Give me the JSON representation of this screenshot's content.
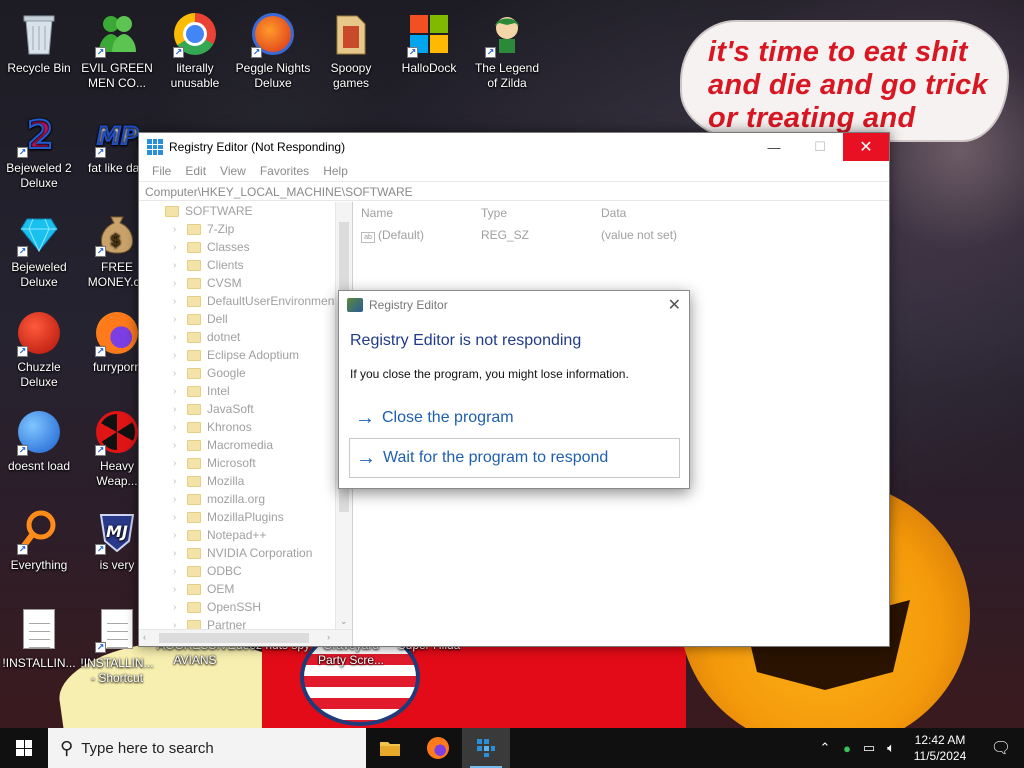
{
  "wallpaper": {
    "sign_line1": "it's time to eat shit",
    "sign_line2": "and die and go trick",
    "sign_line3": "or treating and vote!"
  },
  "desktop_icons": [
    {
      "label": "Recycle Bin",
      "icon": "recycle-bin-icon"
    },
    {
      "label": "EVIL GREEN MEN CO...",
      "icon": "green-men-icon"
    },
    {
      "label": "literally unusable",
      "icon": "chrome-icon"
    },
    {
      "label": "Peggle Nights Deluxe",
      "icon": "peggle-icon"
    },
    {
      "label": "Spoopy games",
      "icon": "folder-icon"
    },
    {
      "label": "HalloDock",
      "icon": "windows-logo-icon"
    },
    {
      "label": "The Legend of Zilda",
      "icon": "zelda-icon"
    },
    {
      "label": "Bejeweled 2 Deluxe",
      "icon": "bejeweled-2-icon"
    },
    {
      "label": "fat like darl",
      "icon": "mpl-icon"
    },
    {
      "label": "Bejeweled Deluxe",
      "icon": "diamond-icon"
    },
    {
      "label": "FREE MONEY.co",
      "icon": "money-bag-icon"
    },
    {
      "label": "Chuzzle Deluxe",
      "icon": "chuzzle-icon"
    },
    {
      "label": "furryporn",
      "icon": "firefox-icon"
    },
    {
      "label": "doesnt load",
      "icon": "thunderbird-icon"
    },
    {
      "label": "Heavy Weap...",
      "icon": "radiation-icon"
    },
    {
      "label": "Everything",
      "icon": "magnifier-icon"
    },
    {
      "label": "is very",
      "icon": "badge-icon"
    },
    {
      "label": "!INSTALLIN...",
      "icon": "text-file-icon"
    },
    {
      "label": "!INSTALLIN... - Shortcut",
      "icon": "text-file-icon"
    },
    {
      "label": "AGGRESSIVE AVIANS",
      "icon": "app-icon"
    },
    {
      "label": "deez nuts spy",
      "icon": "app-icon"
    },
    {
      "label": "Graveyard Party Scre...",
      "icon": "app-icon"
    },
    {
      "label": "Super Hilda",
      "icon": "app-icon"
    }
  ],
  "regedit": {
    "title": "Registry Editor (Not Responding)",
    "menu": [
      "File",
      "Edit",
      "View",
      "Favorites",
      "Help"
    ],
    "address": "Computer\\HKEY_LOCAL_MACHINE\\SOFTWARE",
    "tree_root": "SOFTWARE",
    "tree_items": [
      "7-Zip",
      "Classes",
      "Clients",
      "CVSM",
      "DefaultUserEnvironment",
      "Dell",
      "dotnet",
      "Eclipse Adoptium",
      "Google",
      "Intel",
      "JavaSoft",
      "Khronos",
      "Macromedia",
      "Microsoft",
      "Mozilla",
      "mozilla.org",
      "MozillaPlugins",
      "Notepad++",
      "NVIDIA Corporation",
      "ODBC",
      "OEM",
      "OpenSSH",
      "Partner"
    ],
    "columns": {
      "name": "Name",
      "type": "Type",
      "data": "Data"
    },
    "values": [
      {
        "name": "(Default)",
        "type": "REG_SZ",
        "data": "(value not set)"
      }
    ],
    "buttons": {
      "minimize": "—",
      "maximize": "☐",
      "close": "✕"
    }
  },
  "dialog": {
    "title": "Registry Editor",
    "heading": "Registry Editor is not responding",
    "message": "If you close the program, you might lose information.",
    "option_close": "Close the program",
    "option_wait": "Wait for the program to respond",
    "close_glyph": "✕"
  },
  "taskbar": {
    "search_placeholder": "Type here to search",
    "time": "12:42 AM",
    "date": "11/5/2024",
    "pinned": [
      "file-explorer-icon",
      "firefox-icon",
      "registry-editor-icon"
    ]
  }
}
